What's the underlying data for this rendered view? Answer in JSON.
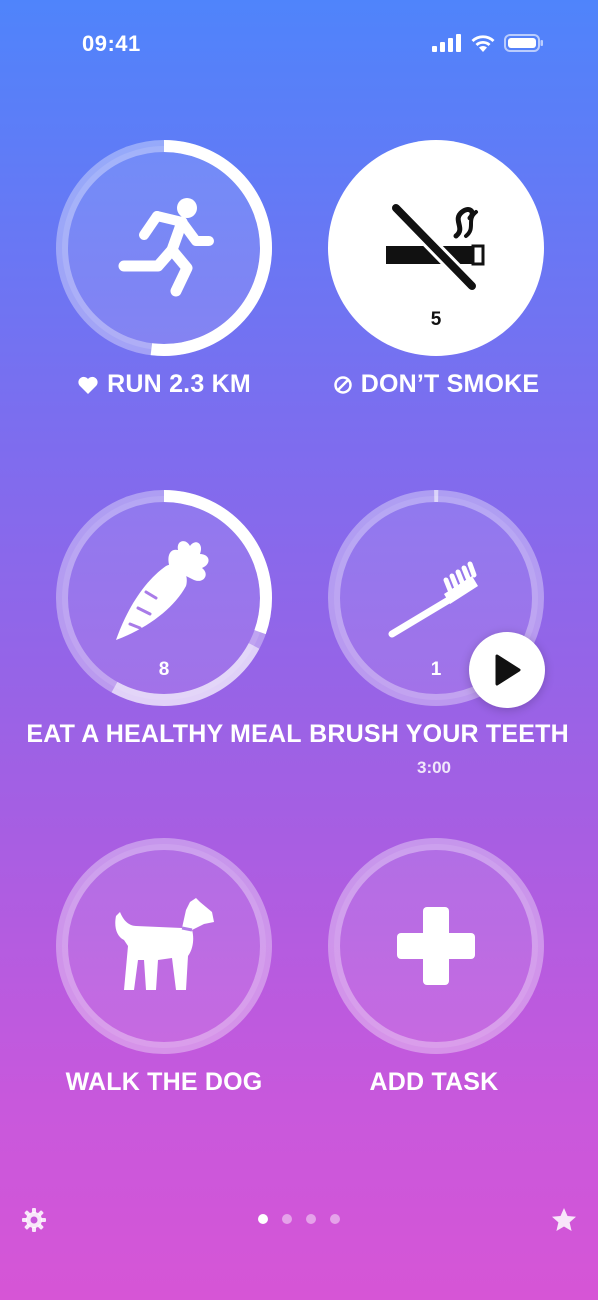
{
  "status_bar": {
    "time": "09:41"
  },
  "tasks": [
    {
      "label": "RUN 2.3 KM",
      "icon": "runner-icon",
      "badge_icon": "heart-icon"
    },
    {
      "label": "DON’T SMOKE",
      "icon": "no-smoking-icon",
      "badge_icon": "no-entry-icon",
      "count": "5"
    },
    {
      "label": "EAT A HEALTHY MEAL",
      "icon": "carrot-icon",
      "count": "8"
    },
    {
      "label": "BRUSH YOUR TEETH",
      "icon": "toothbrush-icon",
      "badge_icon": "heart-icon",
      "count": "1",
      "timer": "3:00"
    },
    {
      "label": "WALK THE DOG",
      "icon": "dog-icon"
    },
    {
      "label": "ADD TASK",
      "icon": "plus-icon"
    }
  ],
  "pagination": {
    "total": 4,
    "active": 0
  },
  "colors": {
    "accent_white": "#ffffff",
    "bg_top": "#4f84fb",
    "bg_bottom": "#d655d6"
  }
}
